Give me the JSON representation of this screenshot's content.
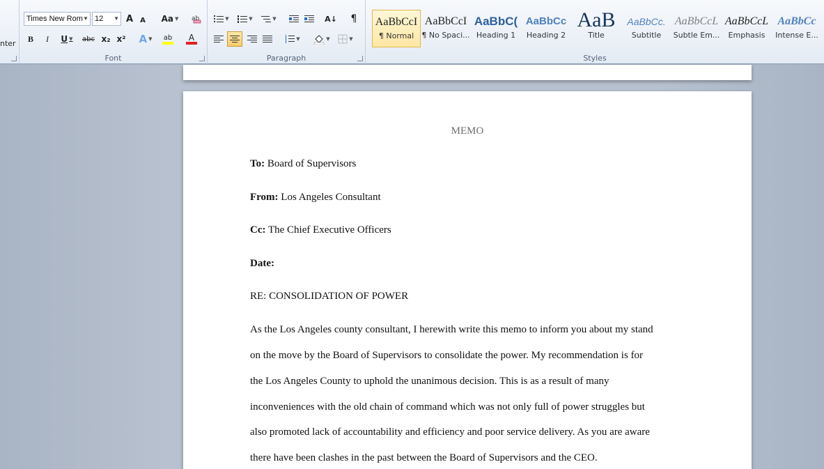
{
  "clipboard": {
    "partial_label": "nter"
  },
  "font": {
    "group_label": "Font",
    "name": "Times New Rom",
    "size": "12",
    "grow_label": "A",
    "shrink_label": "A",
    "case_label": "Aa",
    "bold": "B",
    "italic": "I",
    "underline": "U",
    "strike": "abc",
    "subscript": "x₂",
    "superscript": "x²",
    "effects": "A",
    "highlight": "ab",
    "color": "A"
  },
  "paragraph": {
    "group_label": "Paragraph",
    "sort": "A↓",
    "pilcrow": "¶"
  },
  "styles": {
    "group_label": "Styles",
    "items": [
      {
        "sample": "AaBbCcI",
        "name": "¶ Normal"
      },
      {
        "sample": "AaBbCcI",
        "name": "¶ No Spaci..."
      },
      {
        "sample": "AaBbC(",
        "name": "Heading 1"
      },
      {
        "sample": "AaBbCc",
        "name": "Heading 2"
      },
      {
        "sample": "AaB",
        "name": "Title"
      },
      {
        "sample": "AaBbCc.",
        "name": "Subtitle"
      },
      {
        "sample": "AaBbCcL",
        "name": "Subtle Em..."
      },
      {
        "sample": "AaBbCcL",
        "name": "Emphasis"
      },
      {
        "sample": "AaBbCc",
        "name": "Intense E..."
      }
    ],
    "colors": {
      "selected_border": "#e2b74b",
      "heading": "#2e5f9e",
      "title": "#17365d",
      "subtle": "#7f7f7f"
    }
  },
  "document": {
    "memo_title": "MEMO",
    "to_label": "To:",
    "to_value": " Board of Supervisors",
    "from_label": "From:",
    "from_value": " Los Angeles Consultant",
    "cc_label": "Cc:",
    "cc_value": " The Chief Executive Officers",
    "date_label": "Date:",
    "re_line": "RE: CONSOLIDATION OF POWER",
    "body_lines": [
      "As the Los Angeles county consultant, I herewith write this memo to inform you about my stand",
      "on the move by the Board of Supervisors to consolidate the power. My recommendation is for",
      "the Los Angeles County to uphold the unanimous decision. This is as a result of many",
      "inconveniences with the old chain of command which was not only full of power struggles but",
      "also promoted lack of accountability and efficiency and poor service delivery. As you are aware",
      "there have been clashes in the past between the Board of Supervisors and the CEO."
    ]
  }
}
